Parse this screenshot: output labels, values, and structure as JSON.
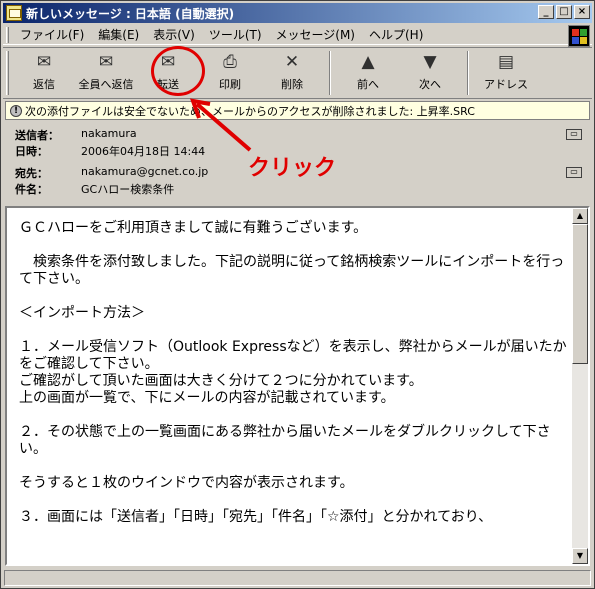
{
  "window": {
    "title": "新しいメッセージ : 日本語 (自動選択)",
    "min_glyph": "_",
    "max_glyph": "□",
    "close_glyph": "×"
  },
  "menu": {
    "items": [
      "ファイル(F)",
      "編集(E)",
      "表示(V)",
      "ツール(T)",
      "メッセージ(M)",
      "ヘルプ(H)"
    ]
  },
  "toolbar": {
    "buttons": [
      {
        "label": "返信",
        "icon": "reply-icon"
      },
      {
        "label": "全員へ返信",
        "icon": "reply-all-icon"
      },
      {
        "label": "転送",
        "icon": "forward-icon"
      },
      {
        "label": "印刷",
        "icon": "print-icon"
      },
      {
        "label": "削除",
        "icon": "delete-icon"
      },
      {
        "label": "前へ",
        "icon": "previous-icon"
      },
      {
        "label": "次へ",
        "icon": "next-icon"
      },
      {
        "label": "アドレス",
        "icon": "address-book-icon"
      }
    ]
  },
  "warning": {
    "icon": "warning-icon",
    "text": "次の添付ファイルは安全でないため、メールからのアクセスが削除されました: 上昇率.SRC"
  },
  "headers": {
    "from_label": "送信者：",
    "from_value": "nakamura",
    "date_label": "日時：",
    "date_value": "2006年04月18日 14:44",
    "to_label": "宛先：",
    "to_value": "nakamura@gcnet.co.jp",
    "subject_label": "件名：",
    "subject_value": "GCハロー検索条件"
  },
  "body": {
    "lines": [
      "ＧＣハローをご利用頂きまして誠に有難うございます。",
      "",
      "　検索条件を添付致しました。下記の説明に従って銘柄検索ツールにインポートを行って下さい。",
      "",
      "＜インポート方法＞",
      "",
      "１．メール受信ソフト（Outlook Expressなど）を表示し、弊社からメールが届いたかをご確認して下さい。",
      "ご確認がして頂いた画面は大きく分けて２つに分かれています。",
      "上の画面が一覧で、下にメールの内容が記載されています。",
      "",
      "２．その状態で上の一覧画面にある弊社から届いたメールをダブルクリックして下さい。",
      "",
      "そうすると１枚のウインドウで内容が表示されます。",
      "",
      "３．画面には「送信者」「日時」「宛先」「件名」「☆添付」と分かれており、"
    ]
  },
  "annotation": {
    "label": "クリック",
    "color": "#e00000"
  }
}
